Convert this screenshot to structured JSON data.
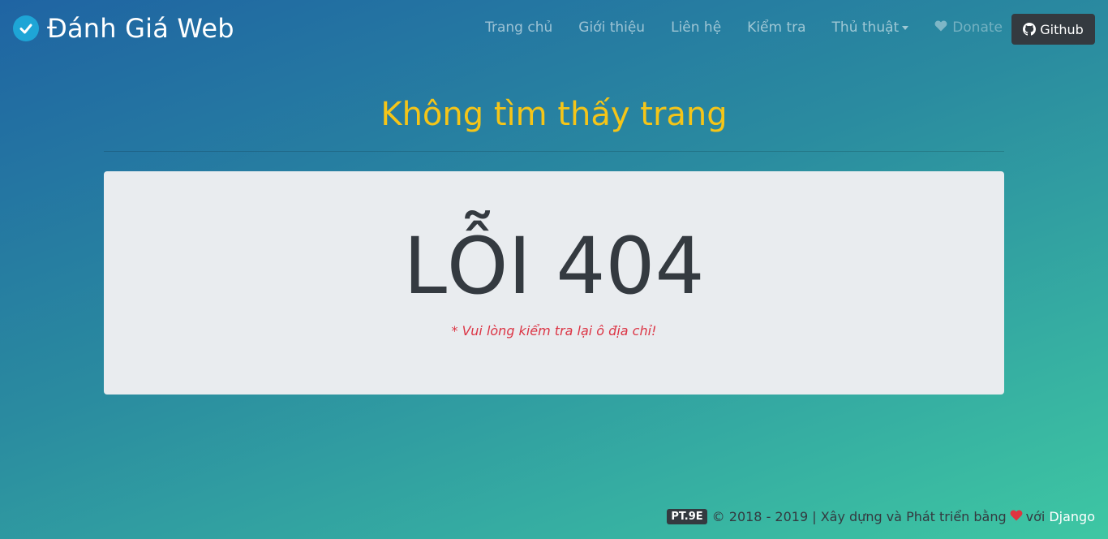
{
  "brand": {
    "name": "Đánh Giá Web",
    "icon": "check-circle-icon"
  },
  "nav": {
    "items": [
      {
        "label": "Trang chủ"
      },
      {
        "label": "Giới thiệu"
      },
      {
        "label": "Liên hệ"
      },
      {
        "label": "Kiểm tra"
      },
      {
        "label": "Thủ thuật"
      },
      {
        "label": "Donate"
      }
    ],
    "github_label": "Github"
  },
  "main": {
    "title": "Không tìm thấy trang",
    "error_code": "LỖI 404",
    "hint": "* Vui lòng kiểm tra lại ô địa chỉ!"
  },
  "footer": {
    "badge": "PT.9E",
    "copyright": "© 2018 - 2019 | Xây dựng và Phát triển bằng",
    "with": "với",
    "link": "Django"
  },
  "colors": {
    "accent_title": "#f5c518",
    "error_hint": "#dc3545",
    "heart": "#e0343f",
    "dark": "#343a40"
  }
}
